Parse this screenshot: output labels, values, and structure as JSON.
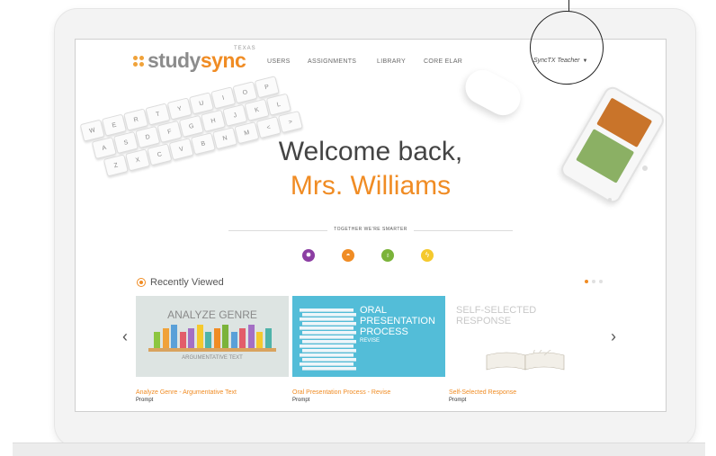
{
  "app": {
    "logo": {
      "study": "study",
      "sync": "sync",
      "region": "TEXAS"
    }
  },
  "nav": {
    "items": [
      "USERS",
      "ASSIGNMENTS",
      "LIBRARY",
      "CORE ELAR"
    ],
    "user_menu": "SyncTX Teacher"
  },
  "hero": {
    "greeting": "Welcome back,",
    "name": "Mrs. Williams",
    "tagline": "TOGETHER WE'RE SMARTER"
  },
  "categories": [
    {
      "icon": "sun-burst-icon",
      "color": "#8c3ea3"
    },
    {
      "icon": "sunrise-icon",
      "color": "#f08c24"
    },
    {
      "icon": "lightbulb-icon",
      "color": "#7bb33a"
    },
    {
      "icon": "lightning-icon",
      "color": "#f5c92d"
    }
  ],
  "recently_viewed": {
    "title": "Recently Viewed",
    "cards": [
      {
        "title": "Analyze Genre - Argumentative Text",
        "type": "Prompt",
        "image_heading": "ANALYZE GENRE",
        "image_sub": "ARGUMENTATIVE TEXT"
      },
      {
        "title": "Oral Presentation Process - Revise",
        "type": "Prompt",
        "image_heading": "ORAL PRESENTATION PROCESS",
        "image_sub": "REVISE"
      },
      {
        "title": "Self-Selected Response",
        "type": "Prompt",
        "image_heading": "SELF-SELECTED RESPONSE"
      }
    ]
  },
  "colors": {
    "accent": "#f08c24",
    "text": "#444444"
  }
}
